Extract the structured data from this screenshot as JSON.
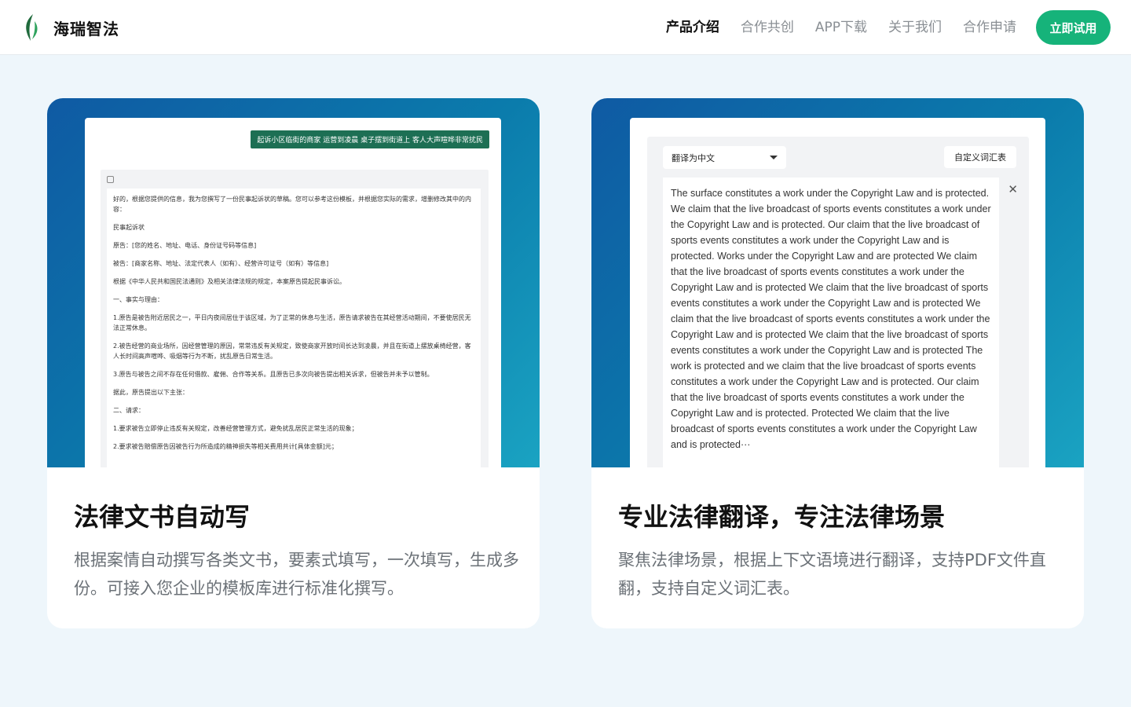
{
  "brand": {
    "name": "海瑞智法"
  },
  "nav": {
    "items": [
      "产品介绍",
      "合作共创",
      "APP下载",
      "关于我们",
      "合作申请"
    ],
    "cta": "立即试用"
  },
  "cards": [
    {
      "title": "法律文书自动写",
      "desc": "根据案情自动撰写各类文书，要素式填写，一次填写，生成多份。可接入您企业的模板库进行标准化撰写。",
      "mock": {
        "banner": "起诉小区临街的商家 运营到凌晨 桌子摆到街道上 客人大声喧哗非常扰民",
        "lines": [
          "好的，根据您提供的信息，我为您撰写了一份民事起诉状的草稿。您可以参考这份模板，并根据您实际的需求，增删修改其中的内容：",
          "民事起诉状",
          "原告：[您的姓名、地址、电话、身份证号码等信息]",
          "被告：[商家名称、地址、法定代表人（如有）、经营许可证号（如有）等信息]",
          "根据《中华人民共和国民法通则》及相关法律法规的规定，本案原告提起民事诉讼。",
          "一、事实与理由：",
          "1.原告是被告附近居民之一，平日内夜间居住于该区域，为了正常的休息与生活，原告请求被告在其经营活动期间，不要使居民无法正常休息。",
          "2.被告经营的商业场所，因经营管理的原因，常常违反有关规定，致使商家开放时间长达到凌晨，并且在街道上摆放桌椅经营，客人长时间高声喧哗、吸烟等行为不断，扰乱原告日常生活。",
          "3.原告与被告之间不存在任何借款、雇佣、合作等关系。且原告已多次向被告提出相关诉求，但被告并未予以管制。",
          "据此，原告提出以下主张：",
          "二、请求：",
          "1.要求被告立即停止违反有关规定，改善经营管理方式，避免扰乱居民正常生活的现象；",
          "2.要求被告赔偿原告因被告行为所造成的精神损失等相关费用共计[具体金额]元；"
        ]
      }
    },
    {
      "title": "专业法律翻译，专注法律场景",
      "desc": "聚焦法律场景，根据上下文语境进行翻译，支持PDF文件直翻，支持自定义词汇表。",
      "mock": {
        "select": "翻译为中文",
        "vocab": "自定义词汇表",
        "close": "✕",
        "text": "The surface constitutes a work under the Copyright Law and is protected. We claim that the live broadcast of sports events constitutes a work under the Copyright Law and is protected. Our claim that the live broadcast of sports events constitutes a work under the Copyright Law and is protected. Works under the Copyright Law and are protected We claim that the live broadcast of sports events constitutes a work under the Copyright Law and is protected We claim that the live broadcast of sports events constitutes a work under the Copyright Law and is protected We claim that the live broadcast of sports events constitutes a work under the Copyright Law and is protected We claim that the live broadcast of sports events constitutes a work under the Copyright Law and is protected The work is protected and we claim that the live broadcast of sports events constitutes a work under the Copyright Law and is protected. Our claim that the live broadcast of sports events constitutes a work under the Copyright Law and is protected. Protected We claim that the live broadcast of sports events constitutes a work under the Copyright Law and is protected···"
      }
    }
  ],
  "colors": {
    "accent": "#16b37a",
    "hero_start": "#0f5aa3",
    "hero_end": "#1aa3c2",
    "background": "#eef6fb"
  }
}
